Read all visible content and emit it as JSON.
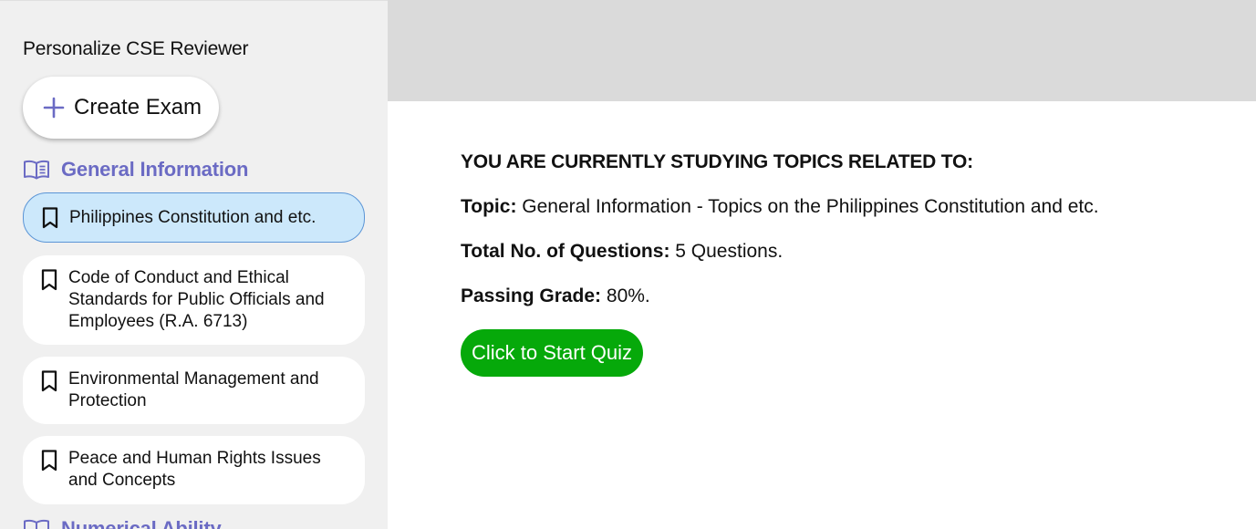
{
  "sidebar": {
    "title": "Personalize CSE Reviewer",
    "create_button": {
      "label": "Create Exam",
      "icon": "plus-icon"
    },
    "sections": [
      {
        "label": "General Information",
        "icon": "book-open-icon",
        "topics": [
          {
            "label": "Philippines Constitution and etc.",
            "icon": "bookmark-icon",
            "active": true
          },
          {
            "label": "Code of Conduct and Ethical Standards for Public Officials and Employees (R.A. 6713)",
            "icon": "bookmark-icon"
          },
          {
            "label": "Environmental Management and Protection",
            "icon": "bookmark-icon"
          },
          {
            "label": "Peace and Human Rights Issues and Concepts",
            "icon": "bookmark-icon"
          }
        ]
      },
      {
        "label": "Numerical Ability",
        "icon": "book-open-icon"
      }
    ]
  },
  "main": {
    "heading": "YOU ARE CURRENTLY STUDYING TOPICS RELATED TO:",
    "topic_label": "Topic:",
    "topic_value": "General Information - Topics on the Philippines Constitution and etc.",
    "questions_label": "Total No. of Questions:",
    "questions_value": "5 Questions.",
    "passing_label": "Passing Grade:",
    "passing_value": "80%.",
    "start_button": "Click to Start Quiz"
  },
  "colors": {
    "accent": "#6b6bc4",
    "active_topic_bg": "#cce8fb",
    "active_topic_border": "#5b95d6",
    "start_button": "#06a90a",
    "sidebar_bg": "#f0f0f0",
    "banner_bg": "#dadada"
  }
}
